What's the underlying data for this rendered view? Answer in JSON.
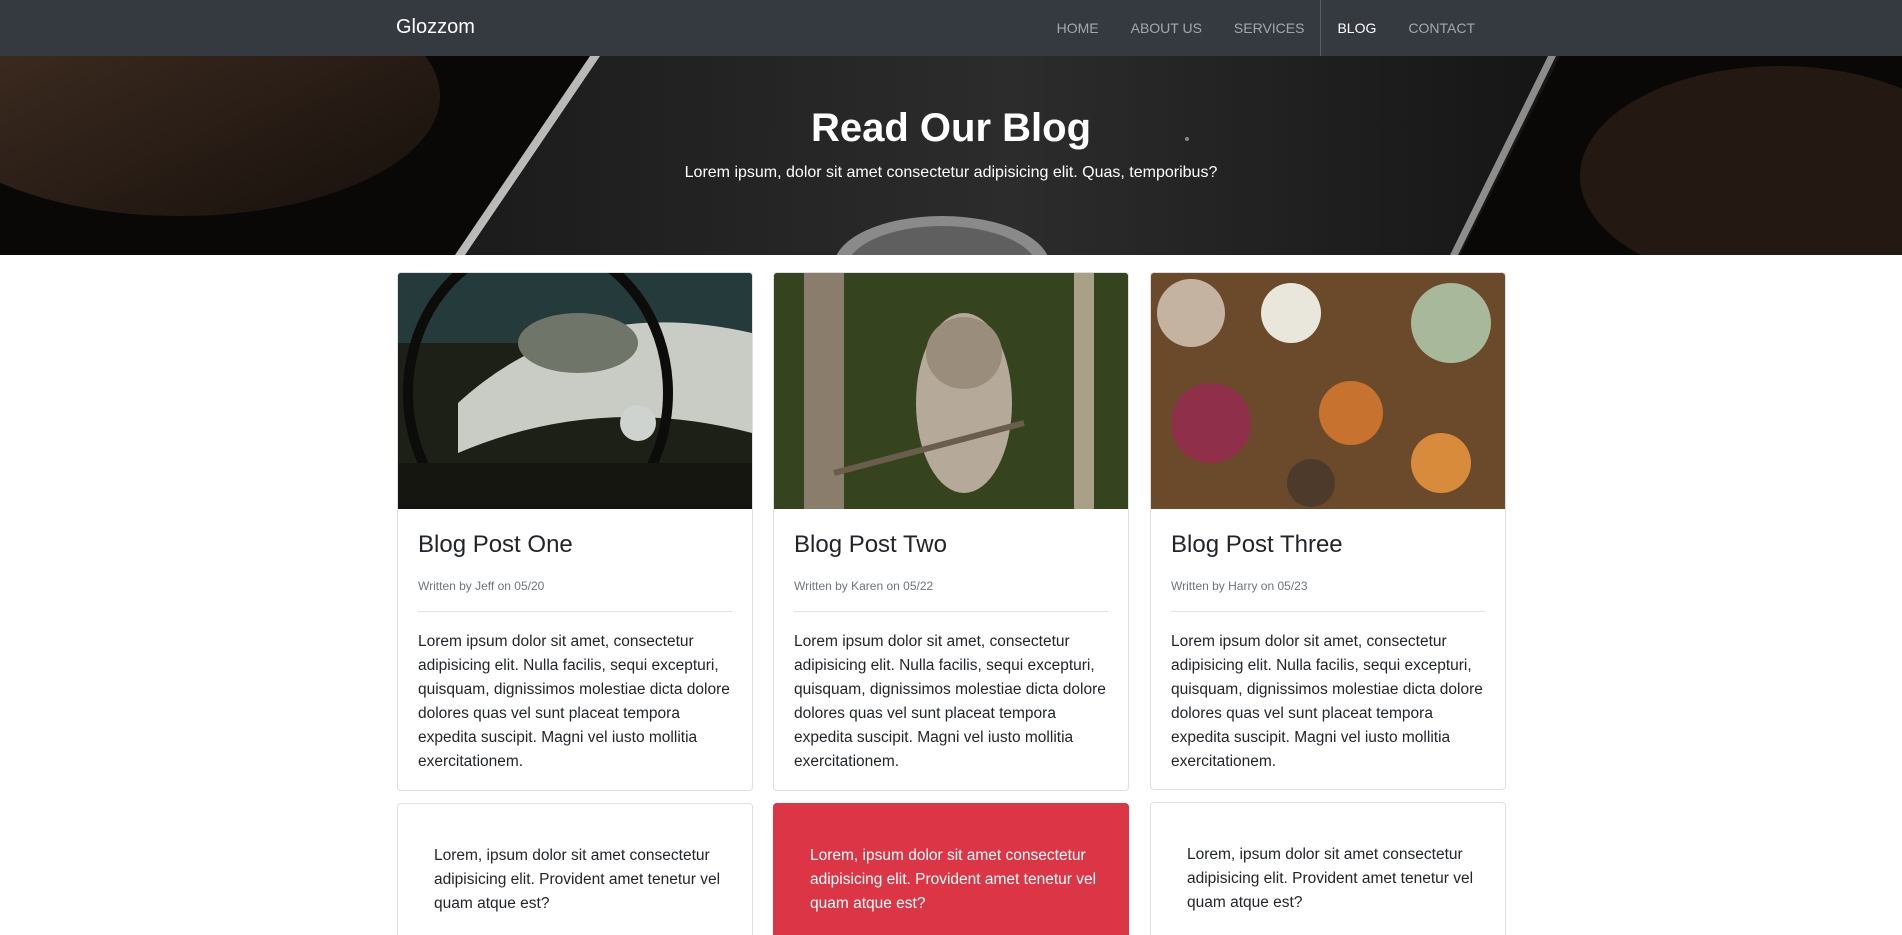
{
  "navbar": {
    "brand": "Glozzom",
    "items": [
      {
        "label": "HOME"
      },
      {
        "label": "ABOUT US"
      },
      {
        "label": "SERVICES"
      },
      {
        "label": "BLOG"
      },
      {
        "label": "CONTACT"
      }
    ],
    "active": "BLOG"
  },
  "hero": {
    "title": "Read Our Blog",
    "subtitle": "Lorem ipsum, dolor sit amet consectetur adipisicing elit. Quas, temporibus?"
  },
  "posts": [
    {
      "title": "Blog Post One",
      "meta": "Written by Jeff on 05/20",
      "text": "Lorem ipsum dolor sit amet, consectetur adipisicing elit. Nulla facilis, sequi excepturi, quisquam, dignissimos molestiae dicta dolore dolores quas vel sunt placeat tempora expedita suscipit. Magni vel iusto mollitia exercitationem.",
      "image": "car-dashboard"
    },
    {
      "title": "Blog Post Two",
      "meta": "Written by Karen on 05/22",
      "text": "Lorem ipsum dolor sit amet, consectetur adipisicing elit. Nulla facilis, sequi excepturi, quisquam, dignissimos molestiae dicta dolore dolores quas vel sunt placeat tempora expedita suscipit. Magni vel iusto mollitia exercitationem.",
      "image": "owl-in-tree"
    },
    {
      "title": "Blog Post Three",
      "meta": "Written by Harry on 05/23",
      "text": "Lorem ipsum dolor sit amet, consectetur adipisicing elit. Nulla facilis, sequi excepturi, quisquam, dignissimos molestiae dicta dolore dolores quas vel sunt placeat tempora expedita suscipit. Magni vel iusto mollitia exercitationem.",
      "image": "dinner-table"
    }
  ],
  "quotes": [
    {
      "text": "Lorem, ipsum dolor sit amet consectetur adipisicing elit. Provident amet tenetur vel quam atque est?"
    },
    {
      "text": "Lorem, ipsum dolor sit amet consectetur adipisicing elit. Provident amet tenetur vel quam atque est?"
    },
    {
      "text": "Lorem, ipsum dolor sit amet consectetur adipisicing elit. Provident amet tenetur vel quam atque est?"
    }
  ],
  "colors": {
    "navbar": "#343a40",
    "danger": "#dc3545"
  }
}
